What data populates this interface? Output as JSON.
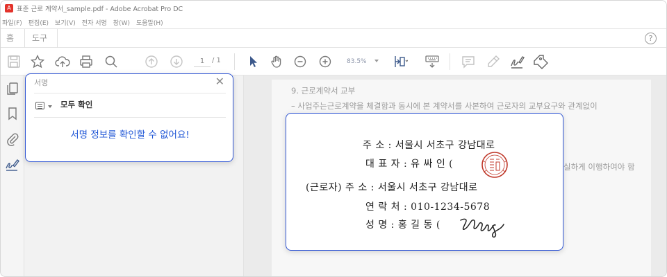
{
  "window": {
    "title": "표준 근로 계약서_sample.pdf - Adobe Acrobat Pro DC",
    "logo_glyph": "A"
  },
  "menubar": {
    "items": [
      "파일(F)",
      "편집(E)",
      "보기(V)",
      "전자 서명",
      "창(W)",
      "도움말(H)"
    ]
  },
  "tabs": {
    "home": "홈",
    "tools": "도구",
    "help_glyph": "?"
  },
  "toolbar": {
    "page_current": "1",
    "page_total": "/ 1",
    "zoom": "83.5%"
  },
  "signature_panel": {
    "title": "서명",
    "close_glyph": "✕",
    "verify_all": "모두 확인",
    "message": "서명 정보를 확인할 수 없어요!"
  },
  "document": {
    "section_heading": "9. 근로계약서 교부",
    "body_line": "– 사업주는근로계약을 체결함과 동시에 본 계약서를 사본하여 근로자의 교부요구와 관계없이",
    "body_line_fragment": "실하게 이행하여야 함"
  },
  "doc_popup": {
    "employer_address": "주 소 : 서울시 서초구 강남대로",
    "representative": "대 표 자 : 유 싸 인 (",
    "employee_address": "(근로자) 주 소 : 서울시 서초구 강남대로",
    "contact": "연 락 처 : 010-1234-5678",
    "name": "성 명 : 홍 길 동 ("
  },
  "colors": {
    "accent": "#1f56d6",
    "panel_border": "#2f55d4",
    "seal": "#c0392b"
  },
  "icons": [
    "save-icon",
    "star-icon",
    "cloud-upload-icon",
    "print-icon",
    "zoom-search-icon",
    "page-up-icon",
    "page-down-icon",
    "select-arrow-icon",
    "hand-icon",
    "zoom-out-icon",
    "zoom-in-icon",
    "fit-page-icon",
    "keyboard-icon",
    "comment-icon",
    "pen-icon",
    "sign-icon",
    "stamp-icon",
    "pages-icon",
    "bookmark-icon",
    "attachment-icon",
    "signature-pane-icon",
    "list-icon",
    "close-icon",
    "help-icon"
  ]
}
